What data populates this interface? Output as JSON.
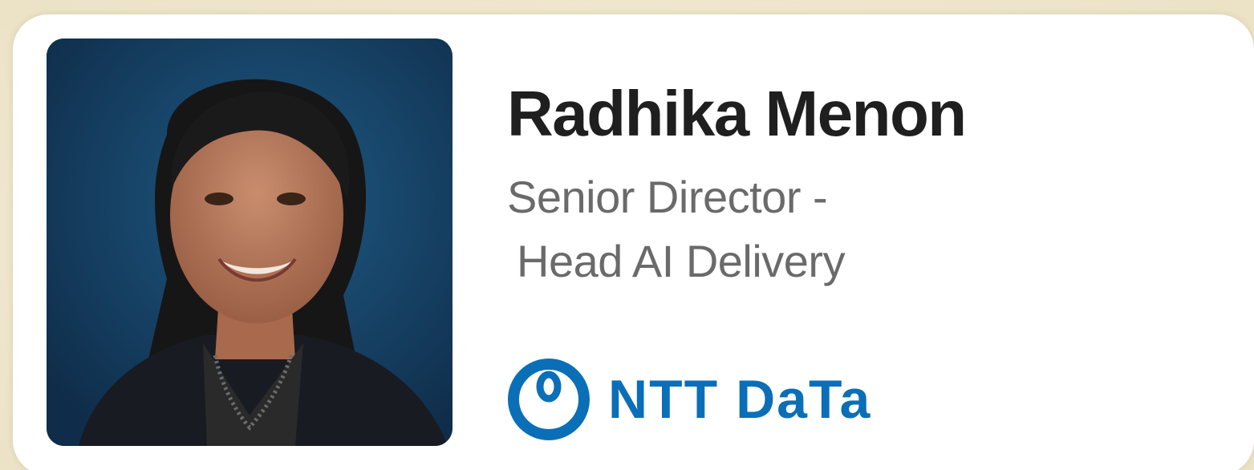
{
  "profile": {
    "name": "Radhika Menon",
    "title_line1": "Senior Director -",
    "title_line2": "Head AI Delivery"
  },
  "company": {
    "logo_text": "NTT DaTa",
    "logo_icon": "ntt-data-ring-icon",
    "brand_color": "#0a6fb7"
  },
  "colors": {
    "photo_background": "#163a5e",
    "name": "#1f1f1f",
    "title": "#6a6a6a"
  }
}
